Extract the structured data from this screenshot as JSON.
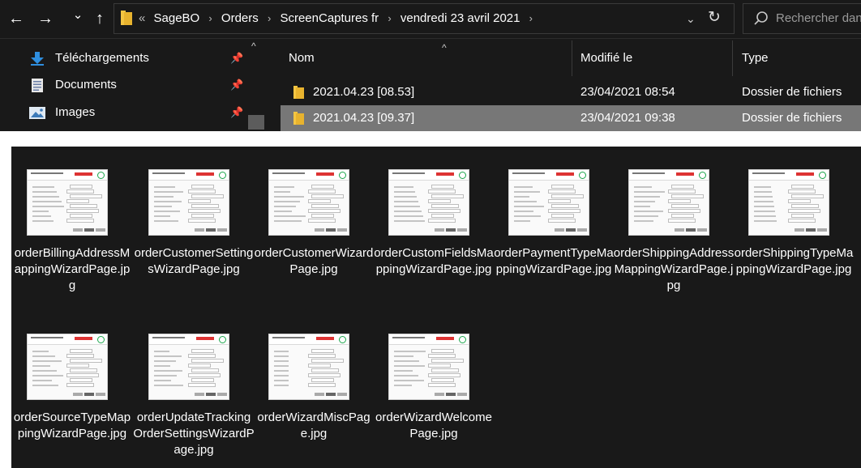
{
  "toolbar": {
    "back_glyph": "←",
    "forward_glyph": "→",
    "recent_glyph": "⌄",
    "up_glyph": "↑"
  },
  "address": {
    "overflow": "«",
    "crumbs": [
      "SageBO",
      "Orders",
      "ScreenCaptures fr",
      "vendredi 23 avril 2021"
    ],
    "separator": "›",
    "dropdown_glyph": "⌄",
    "refresh_glyph": "↻"
  },
  "search": {
    "placeholder": "Rechercher dans :"
  },
  "nav": {
    "items": [
      {
        "label": "Téléchargements",
        "icon": "download-icon"
      },
      {
        "label": "Documents",
        "icon": "documents-icon"
      },
      {
        "label": "Images",
        "icon": "images-icon"
      }
    ],
    "pin_glyph": "📌",
    "scroll_up_glyph": "^"
  },
  "columns": {
    "name": "Nom",
    "modified": "Modifié le",
    "type": "Type"
  },
  "files": [
    {
      "name": "2021.04.23 [08.53]",
      "modified": "23/04/2021 08:54",
      "type": "Dossier de fichiers",
      "selected": false
    },
    {
      "name": "2021.04.23 [09.37]",
      "modified": "23/04/2021 09:38",
      "type": "Dossier de fichiers",
      "selected": true
    }
  ],
  "thumbnails": [
    {
      "filename": "orderBillingAddressMappingWizardPage.jpg"
    },
    {
      "filename": "orderCustomerSettingsWizardPage.jpg"
    },
    {
      "filename": "orderCustomerWizardPage.jpg"
    },
    {
      "filename": "orderCustomFieldsMappingWizardPage.jpg"
    },
    {
      "filename": "orderPaymentTypeMappingWizardPage.jpg"
    },
    {
      "filename": "orderShippingAddressMappingWizardPage.jpg"
    },
    {
      "filename": "orderShippingTypeMappingWizardPage.jpg"
    },
    {
      "filename": "orderSourceTypeMappingWizardPage.jpg"
    },
    {
      "filename": "orderUpdateTrackingOrderSettingsWizardPage.jpg"
    },
    {
      "filename": "orderWizardMiscPage.jpg"
    },
    {
      "filename": "orderWizardWelcomePage.jpg"
    }
  ],
  "colors": {
    "background_dark": "#191919",
    "selection": "#777777",
    "folder_yellow": "#f4c542",
    "accent_blue": "#2f8fe0"
  }
}
